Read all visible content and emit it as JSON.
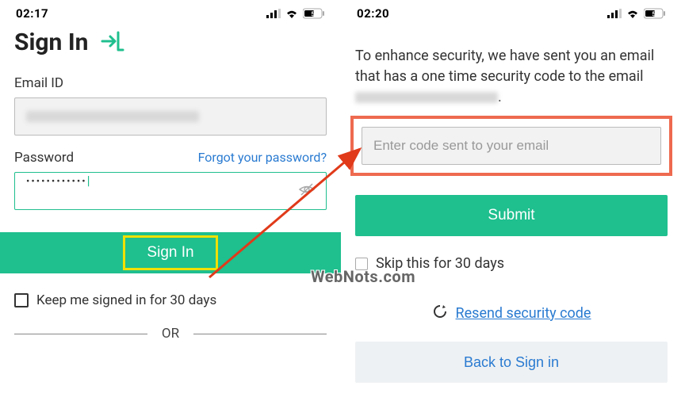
{
  "left": {
    "status": {
      "time": "02:17",
      "battery": "53"
    },
    "title": "Sign In",
    "email_label": "Email ID",
    "password_label": "Password",
    "forgot_link": "Forgot your password?",
    "password_value": "••••••••••••",
    "signin_button": "Sign In",
    "keep_signed_label": "Keep me signed in for 30 days",
    "or_text": "OR"
  },
  "right": {
    "status": {
      "time": "02:20",
      "battery": "53"
    },
    "security_msg_part1": "To enhance security, we have sent you an email that has a one time security code to the email ",
    "security_msg_part2": ".",
    "code_placeholder": "Enter code sent to your email",
    "submit_button": "Submit",
    "skip_label": "Skip this for 30 days",
    "resend_link": "Resend security code",
    "back_button": "Back to Sign in"
  },
  "watermark": "WebNots.com"
}
